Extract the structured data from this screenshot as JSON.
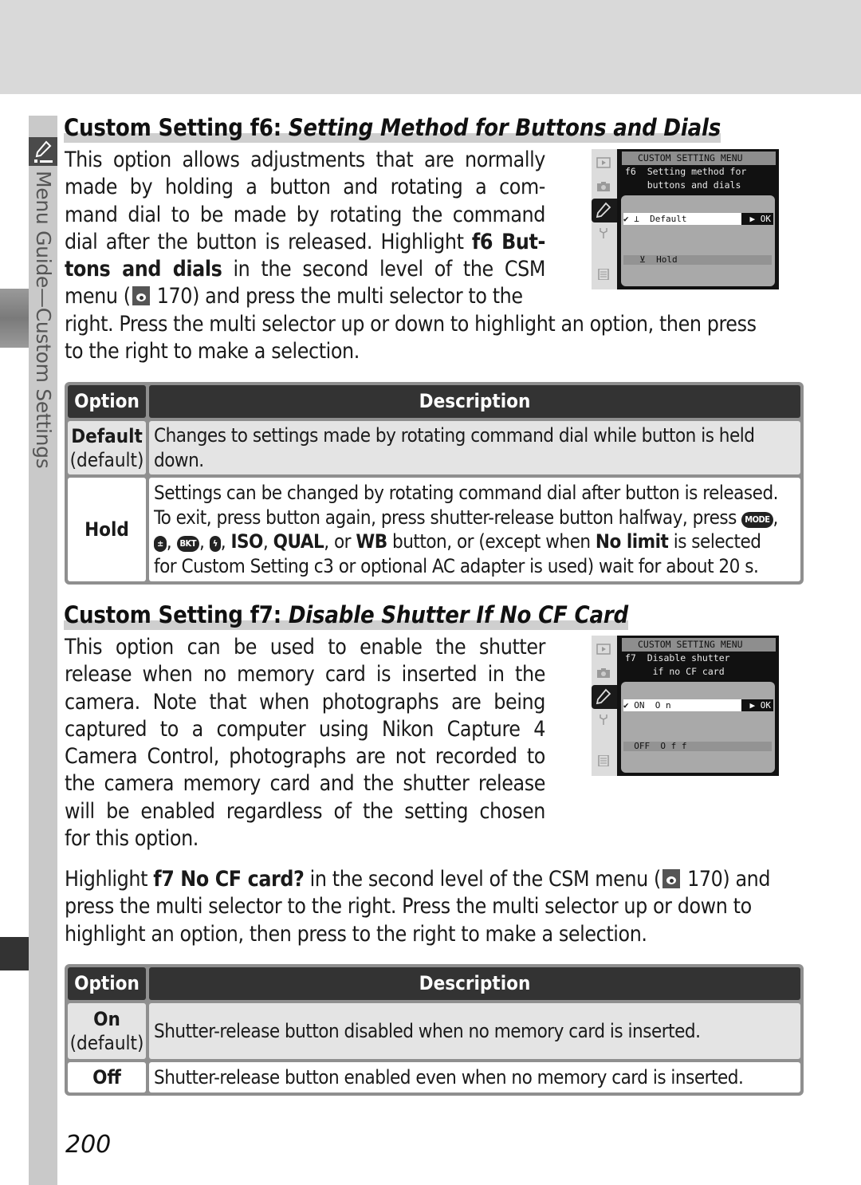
{
  "sidebar": {
    "section_label": "Menu Guide—Custom Settings",
    "section_icon": "pencil-icon"
  },
  "f6": {
    "heading_prefix": "Custom Setting f6: ",
    "heading_title": "Setting Method for Buttons and Dials",
    "para": {
      "l1": "This option allows adjustments that are normally",
      "l2": "made by holding a button and rotating a com-",
      "l3": "mand dial to be made by rotating the command",
      "l4a": "dial after the button is released.  Highlight ",
      "l4b": "f6 But-",
      "l5a": "tons and dials",
      "l5b": " in the second level of the CSM",
      "l6a": "menu (",
      "l6b": " 170) and press the multi selector to the",
      "l7": "right.  Press the multi selector up or down to highlight an option, then press",
      "l8": "to the right to make a selection."
    },
    "screen": {
      "title": "CUSTOM SETTING MENU",
      "sub": "f6  Setting method for\n    buttons and dials",
      "selected": "✔ ⊥  Default",
      "ok": "▶ OK",
      "other": "   ⊻  Hold"
    },
    "table": {
      "headers": [
        "Option",
        "Description"
      ],
      "rows": [
        {
          "option": "Default",
          "option_note": "(default)",
          "description": "Changes to settings made by rotating command dial while button is held down."
        },
        {
          "option": "Hold",
          "d1": "Settings can be changed by rotating command dial after button is released.",
          "d2": "To exit, press button again, press shutter-release button halfway, press ",
          "btn_mode": "MODE",
          "btn_ev": "±",
          "btn_bkt": "BKT",
          "btn_flash": "ϟ",
          "d3a": ", ",
          "iso": "ISO",
          "qual": "QUAL",
          "wb": "WB",
          "d3b": " button, or (except when ",
          "nolimit": "No limit",
          "d3c": " is selected",
          "d4": "for Custom Setting c3 or optional AC adapter is used) wait for about 20 s."
        }
      ]
    }
  },
  "f7": {
    "heading_prefix": "Custom Setting f7: ",
    "heading_title": "Disable Shutter If No CF Card",
    "para": [
      "This option can be used to enable the shutter",
      "release when no memory card is inserted in the",
      "camera.  Note that when photographs are being",
      "captured to a computer using Nikon Capture 4",
      "Camera Control, photographs are not recorded to",
      "the camera memory card and the shutter release",
      "will be enabled regardless of the setting chosen",
      "for this option."
    ],
    "para2": {
      "l1a": "Highlight ",
      "l1b": "f7 No CF card?",
      "l1c": " in the second level of the CSM menu (",
      "l1d": " 170) and",
      "l2": "press the multi selector to the right.  Press the multi selector up or down to",
      "l3": "highlight an option, then press to the right to make a selection."
    },
    "screen": {
      "title": "CUSTOM SETTING MENU",
      "sub": "f7  Disable shutter\n     if no CF card",
      "selected": "✔ ON  O n",
      "ok": "▶ OK",
      "other": "  OFF  O f f"
    },
    "table": {
      "headers": [
        "Option",
        "Description"
      ],
      "rows": [
        {
          "option": "On",
          "option_note": "(default)",
          "description": "Shutter-release button disabled when no memory card is inserted."
        },
        {
          "option": "Off",
          "description": "Shutter-release button enabled even when no memory card is inserted."
        }
      ]
    }
  },
  "page_number": "200"
}
